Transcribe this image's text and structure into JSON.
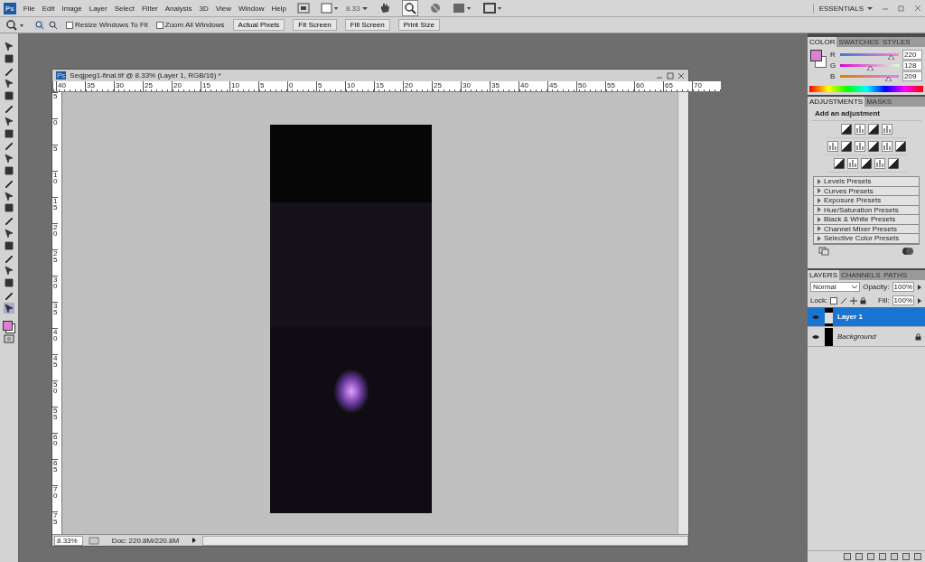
{
  "logo": "Ps",
  "menu": [
    "File",
    "Edit",
    "Image",
    "Layer",
    "Select",
    "Filter",
    "Analysis",
    "3D",
    "View",
    "Window",
    "Help"
  ],
  "zoom_menu": "8.33",
  "workspace": "ESSENTIALS",
  "options": {
    "checkboxes": [
      {
        "label": "Resize Windows To Fit",
        "checked": false
      },
      {
        "label": "Zoom All Windows",
        "checked": false
      }
    ],
    "buttons": [
      "Actual Pixels",
      "Fit Screen",
      "Fill Screen",
      "Print Size"
    ]
  },
  "document": {
    "icon": "Ps",
    "title": "Seqjpeg1-final.tif @ 8.33% (Layer 1, RGB/16) *",
    "top_ruler": [
      "40",
      "35",
      "30",
      "25",
      "20",
      "15",
      "10",
      "5",
      "0",
      "5",
      "10",
      "15",
      "20",
      "25",
      "30",
      "35",
      "40",
      "45",
      "50",
      "55",
      "60",
      "65",
      "70"
    ],
    "left_ruler": [
      "5",
      "0",
      "5",
      "10",
      "15",
      "20",
      "25",
      "30",
      "35",
      "40",
      "45",
      "50",
      "55",
      "60",
      "65",
      "70",
      "75"
    ],
    "zoom": "8.33%",
    "doc_size": "Doc: 220.8M/220.8M"
  },
  "color_panel": {
    "tabs": [
      {
        "label": "COLOR",
        "selected": true
      },
      {
        "label": "SWATCHES",
        "selected": false
      },
      {
        "label": "STYLES",
        "selected": false
      }
    ],
    "channels": [
      {
        "name": "R",
        "level": 0.86,
        "value": "220"
      },
      {
        "name": "G",
        "level": 0.5,
        "value": "128"
      },
      {
        "name": "B",
        "level": 0.82,
        "value": "209"
      }
    ]
  },
  "adjustments_panel": {
    "tabs": [
      {
        "label": "ADJUSTMENTS",
        "selected": true
      },
      {
        "label": "MASKS",
        "selected": false
      }
    ],
    "heading": "Add an adjustment",
    "presets": [
      "Levels Presets",
      "Curves Presets",
      "Exposure Presets",
      "Hue/Saturation Presets",
      "Black & White Presets",
      "Channel Mixer Presets",
      "Selective Color Presets"
    ]
  },
  "layers_panel": {
    "tabs": [
      {
        "label": "LAYERS",
        "selected": true
      },
      {
        "label": "CHANNELS",
        "selected": false
      },
      {
        "label": "PATHS",
        "selected": false
      }
    ],
    "blend_mode": "Normal",
    "opacity_label": "Opacity:",
    "opacity": "100%",
    "lock_label": "Lock:",
    "fill_label": "Fill:",
    "fill": "100%",
    "layers": [
      {
        "name": "Layer 1",
        "selected": true,
        "visible": true,
        "locked": false
      },
      {
        "name": "Background",
        "selected": false,
        "visible": true,
        "locked": true
      }
    ]
  }
}
